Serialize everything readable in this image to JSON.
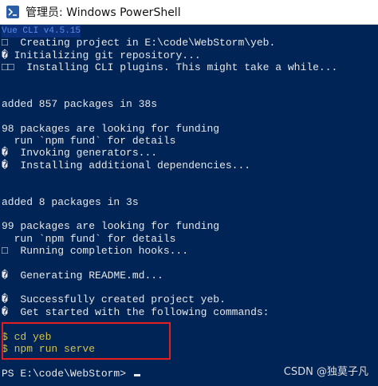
{
  "window": {
    "title": "管理员: Windows PowerShell"
  },
  "console": {
    "lines": [
      "Vue CLI v4.5.15",
      "□  Creating project in E:\\code\\WebStorm\\yeb.",
      "� Initializing git repository...",
      "□□  Installing CLI plugins. This might take a while...",
      "",
      "",
      "added 857 packages in 38s",
      "",
      "98 packages are looking for funding",
      "  run `npm fund` for details",
      "�  Invoking generators...",
      "�  Installing additional dependencies...",
      "",
      "",
      "added 8 packages in 3s",
      "",
      "99 packages are looking for funding",
      "  run `npm fund` for details",
      "□  Running completion hooks...",
      "",
      "�  Generating README.md...",
      "",
      "�  Successfully created project yeb.",
      "�  Get started with the following commands:",
      "",
      "$ cd yeb",
      "$ npm run serve",
      "",
      "PS E:\\code\\WebStorm> "
    ]
  },
  "watermark": "CSDN @独莫子凡",
  "colors": {
    "background": "#012456",
    "text": "#e8e8e8",
    "command_text": "#d4c24a",
    "highlight_border": "#e02020"
  },
  "icons": {
    "app": "powershell-icon"
  }
}
